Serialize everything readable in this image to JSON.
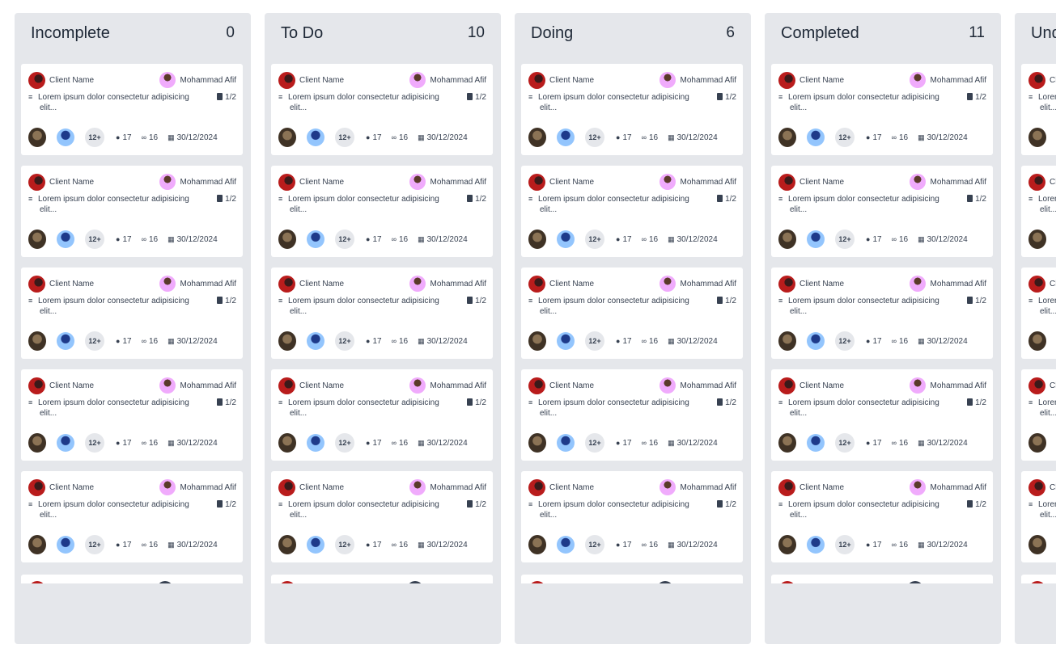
{
  "columns": [
    {
      "title": "Incomplete",
      "count": "0"
    },
    {
      "title": "To Do",
      "count": "10"
    },
    {
      "title": "Doing",
      "count": "6"
    },
    {
      "title": "Completed",
      "count": "11"
    },
    {
      "title": "Und",
      "count": ""
    }
  ],
  "card": {
    "client": "Client Name",
    "assignee": "Mohammad Afif",
    "desc": "Lorem ipsum dolor consectetur adipisicing",
    "desc_cont": "elit...",
    "tasks": "1/2",
    "more": "12+",
    "comments": "17",
    "attachments": "16",
    "date": "30/12/2024"
  },
  "icons": {
    "layers": "layers-icon",
    "clipboard": "clipboard-icon",
    "comment": "comment-icon",
    "paperclip": "paperclip-icon",
    "calendar": "calendar-icon"
  },
  "colors": {
    "column_bg": "#e5e7eb",
    "card_bg": "#ffffff",
    "text": "#374151"
  }
}
